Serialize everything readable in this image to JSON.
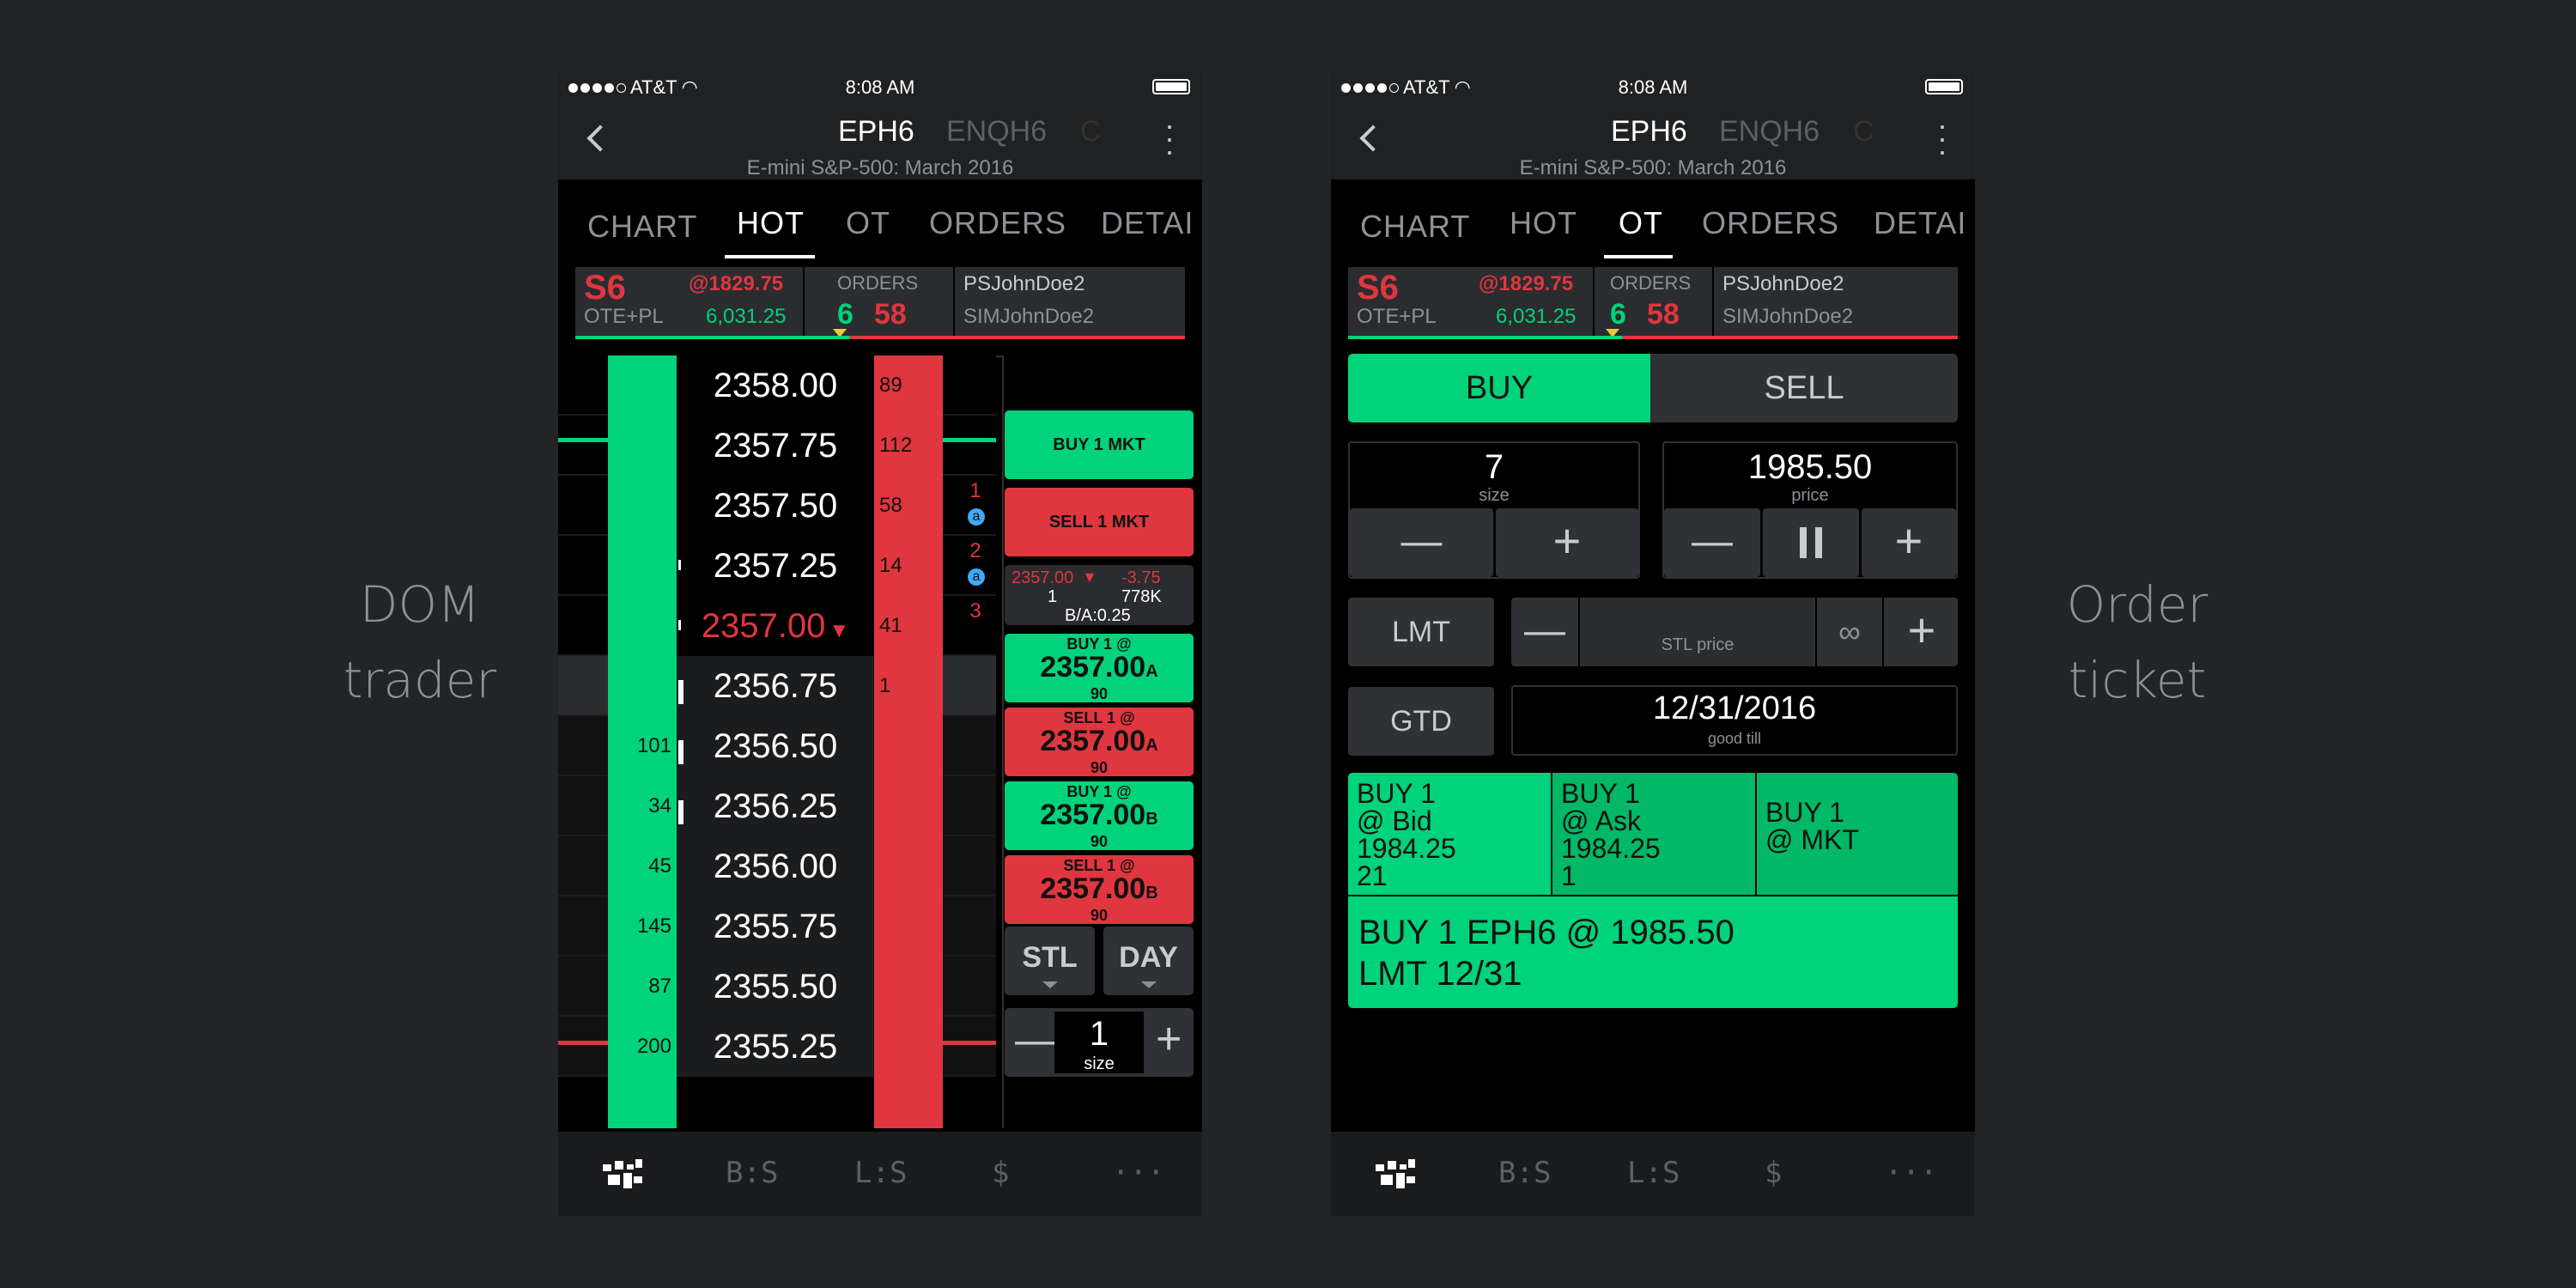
{
  "captions": {
    "left": [
      "DOM",
      "trader"
    ],
    "right": [
      "Order",
      "ticket"
    ]
  },
  "colors": {
    "green": "#00d37b",
    "red": "#e0363f",
    "bg": "#222426"
  },
  "status": {
    "carrier": "AT&T",
    "time": "8:08 AM"
  },
  "nav": {
    "symbol": "EPH6",
    "next_symbol": "ENQH6",
    "next2": "C",
    "subtitle": "E-mini S&P-500: March 2016"
  },
  "tabs": [
    "CHART",
    "HOT",
    "OT",
    "ORDERS",
    "DETAI"
  ],
  "account": {
    "pos": "S6",
    "pos_price": "@1829.75",
    "ote_label": "OTE+PL",
    "ote_value": "6,031.25",
    "orders_label": "ORDERS",
    "orders_buy": "6",
    "orders_sell": "58",
    "acct1": "PSJohnDoe2",
    "acct2": "SIMJohnDoe2"
  },
  "dom": {
    "rows": [
      {
        "price": "2358.00",
        "ask": "89",
        "bid": "",
        "side": ""
      },
      {
        "price": "2357.75",
        "ask": "112",
        "bid": "",
        "side": ""
      },
      {
        "price": "2357.50",
        "ask": "58",
        "bid": "",
        "side": "1"
      },
      {
        "price": "2357.25",
        "ask": "14",
        "bid": "",
        "side": "2"
      },
      {
        "price": "2357.00",
        "ask": "41",
        "bid": "",
        "side": "3"
      },
      {
        "price": "2356.75",
        "ask": "1",
        "bid": "",
        "side": ""
      },
      {
        "price": "2356.50",
        "ask": "",
        "bid": "101",
        "side": ""
      },
      {
        "price": "2356.25",
        "ask": "",
        "bid": "34",
        "side": ""
      },
      {
        "price": "2356.00",
        "ask": "",
        "bid": "45",
        "side": ""
      },
      {
        "price": "2355.75",
        "ask": "",
        "bid": "145",
        "side": ""
      },
      {
        "price": "2355.50",
        "ask": "",
        "bid": "87",
        "side": ""
      },
      {
        "price": "2355.25",
        "ask": "",
        "bid": "200",
        "side": ""
      }
    ],
    "badge_a": "a",
    "buy_mkt": "BUY 1 MKT",
    "sell_mkt": "SELL 1 MKT",
    "last": "2357.00",
    "last_qty": "1",
    "change": "-3.75",
    "volume": "778K",
    "ba": "B/A:0.25",
    "orders": [
      {
        "label": "BUY 1 @",
        "price": "2357.00",
        "suffix": "A",
        "qty": "90",
        "color": "green"
      },
      {
        "label": "SELL 1 @",
        "price": "2357.00",
        "suffix": "A",
        "qty": "90",
        "color": "red"
      },
      {
        "label": "BUY 1 @",
        "price": "2357.00",
        "suffix": "B",
        "qty": "90",
        "color": "green"
      },
      {
        "label": "SELL 1 @",
        "price": "2357.00",
        "suffix": "B",
        "qty": "90",
        "color": "red"
      }
    ],
    "stl": "STL",
    "day": "DAY",
    "size": "1",
    "size_label": "size"
  },
  "ticket": {
    "buy": "BUY",
    "sell": "SELL",
    "size": "7",
    "size_label": "size",
    "price": "1985.50",
    "price_label": "price",
    "lmt": "LMT",
    "stl_price": "STL price",
    "gtd": "GTD",
    "date": "12/31/2016",
    "good_till": "good till",
    "quick": [
      {
        "l1": "BUY 1",
        "l2": "@ Bid",
        "l3": "1984.25",
        "l4": "21"
      },
      {
        "l1": "BUY 1",
        "l2": "@ Ask",
        "l3": "1984.25",
        "l4": "1"
      },
      {
        "l1": "BUY 1",
        "l2": "@ MKT",
        "l3": "",
        "l4": ""
      }
    ],
    "summary1": "BUY 1 EPH6 @ 1985.50",
    "summary2": "LMT 12/31"
  },
  "bottom_nav": {
    "bs": "B:S",
    "ls": "L:S",
    "dollar": "$",
    "more": "···"
  }
}
